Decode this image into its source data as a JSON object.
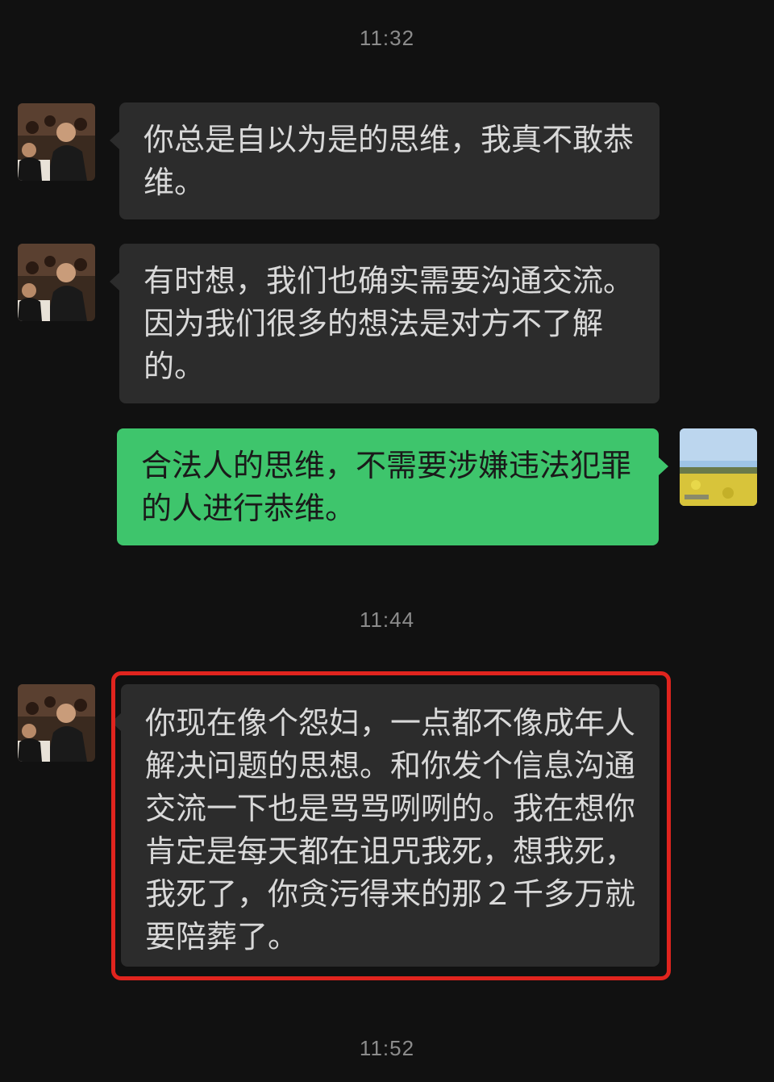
{
  "chat": {
    "timestamps": [
      "11:32",
      "11:44",
      "11:52"
    ],
    "messages": [
      {
        "sender": "contact",
        "text": "你总是自以为是的思维，我真不敢恭维。"
      },
      {
        "sender": "contact",
        "text": "有时想，我们也确实需要沟通交流。因为我们很多的想法是对方不了解的。"
      },
      {
        "sender": "self",
        "text": "合法人的思维，不需要涉嫌违法犯罪的人进行恭维。"
      },
      {
        "sender": "contact",
        "text": "你现在像个怨妇，一点都不像成年人解决问题的思想。和你发个信息沟通交流一下也是骂骂咧咧的。我在想你肯定是每天都在诅咒我死，想我死，我死了，你贪污得来的那２千多万就要陪葬了。",
        "highlighted": true
      }
    ]
  },
  "colors": {
    "background": "#111111",
    "incoming_bubble": "#2c2c2c",
    "outgoing_bubble": "#3ec56c",
    "highlight": "#e0241e",
    "timestamp": "#8c8c8c"
  },
  "icons": {
    "contact_avatar": "person-photo-avatar",
    "self_avatar": "landscape-photo-avatar"
  }
}
